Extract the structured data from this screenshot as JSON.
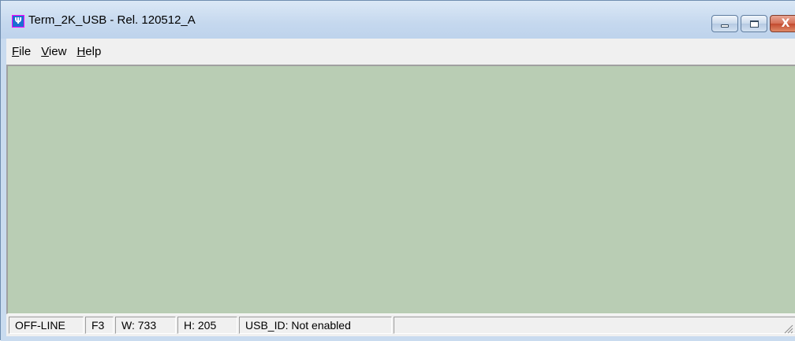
{
  "window": {
    "title": "Term_2K_USB - Rel. 120512_A",
    "app_icon_glyph": "Ψ"
  },
  "caption_buttons": {
    "close_glyph": "X"
  },
  "menu": {
    "items": [
      {
        "underline": "F",
        "rest": "ile"
      },
      {
        "underline": "V",
        "rest": "iew"
      },
      {
        "underline": "H",
        "rest": "elp"
      }
    ]
  },
  "client": {
    "background_color": "#b9cdb4"
  },
  "statusbar": {
    "connection": "OFF-LINE",
    "font_key": "F3",
    "width": "W: 733",
    "height": "H: 205",
    "usb_id": "USB_ID: Not enabled",
    "extra": ""
  },
  "colors": {
    "titlebar": "#c5d8ee",
    "close_button": "#c24a2e",
    "menubar": "#f0f0f0"
  },
  "icons": [
    "usb-app-icon",
    "minimize-icon",
    "maximize-icon",
    "close-icon",
    "size-grip-icon"
  ]
}
